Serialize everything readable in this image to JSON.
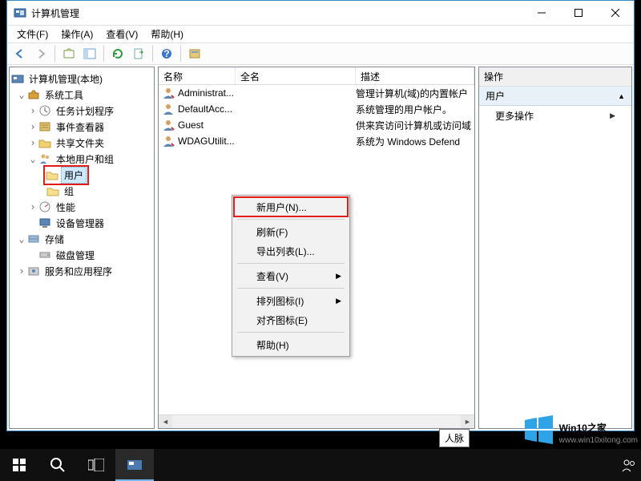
{
  "title": "计算机管理",
  "menus": [
    "文件(F)",
    "操作(A)",
    "查看(V)",
    "帮助(H)"
  ],
  "tree": {
    "root": "计算机管理(本地)",
    "system_tools": "系统工具",
    "task_scheduler": "任务计划程序",
    "event_viewer": "事件查看器",
    "shared_folders": "共享文件夹",
    "local_users_groups": "本地用户和组",
    "users": "用户",
    "groups": "组",
    "performance": "性能",
    "device_manager": "设备管理器",
    "storage": "存储",
    "disk_mgmt": "磁盘管理",
    "services_apps": "服务和应用程序"
  },
  "list": {
    "headers": {
      "name": "名称",
      "fullname": "全名",
      "desc": "描述"
    },
    "rows": [
      {
        "name": "Administrat...",
        "full": "",
        "desc": "管理计算机(域)的内置帐户"
      },
      {
        "name": "DefaultAcc...",
        "full": "",
        "desc": "系统管理的用户帐户。"
      },
      {
        "name": "Guest",
        "full": "",
        "desc": "供来宾访问计算机或访问域"
      },
      {
        "name": "WDAGUtilit...",
        "full": "",
        "desc": "系统为 Windows Defend"
      }
    ]
  },
  "actions": {
    "header": "操作",
    "section": "用户",
    "more": "更多操作"
  },
  "context": {
    "new_user": "新用户(N)...",
    "refresh": "刷新(F)",
    "export": "导出列表(L)...",
    "view": "查看(V)",
    "arrange": "排列图标(I)",
    "align": "对齐图标(E)",
    "help": "帮助(H)"
  },
  "tooltip": "人脉",
  "branding": {
    "name": "Win10",
    "suffix": "之家",
    "url": "www.win10xitong.com"
  }
}
